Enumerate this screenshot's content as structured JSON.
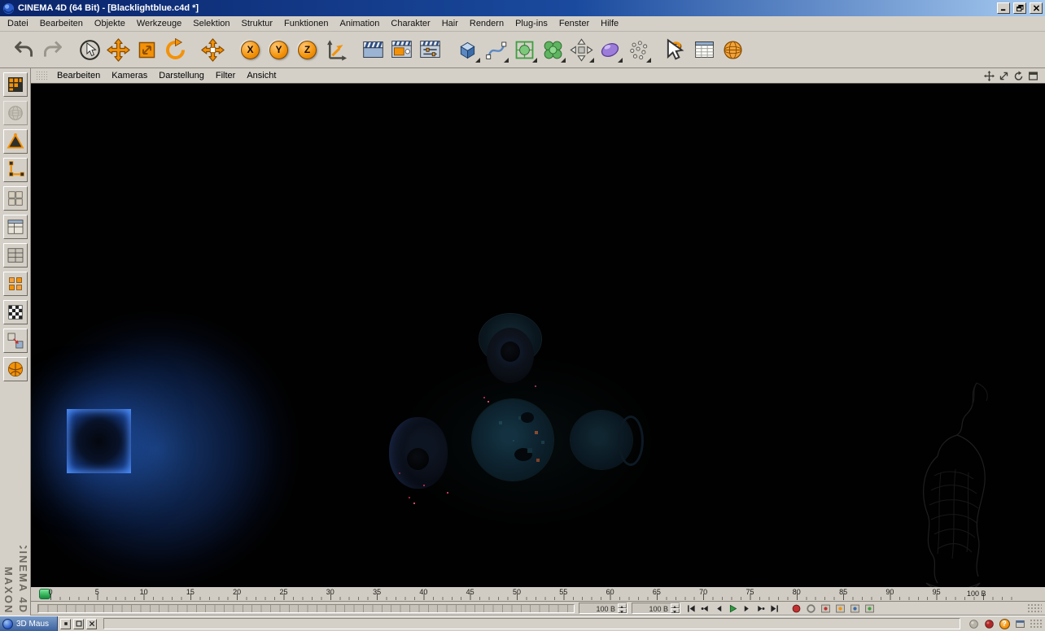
{
  "window": {
    "title": "CINEMA 4D (64 Bit) - [Blacklightblue.c4d *]",
    "control_icons": [
      "minimize-icon",
      "restore-icon",
      "close-icon"
    ]
  },
  "menubar": {
    "items": [
      "Datei",
      "Bearbeiten",
      "Objekte",
      "Werkzeuge",
      "Selektion",
      "Struktur",
      "Funktionen",
      "Animation",
      "Charakter",
      "Hair",
      "Rendern",
      "Plug-ins",
      "Fenster",
      "Hilfe"
    ]
  },
  "toolbar": {
    "icons": [
      {
        "name": "undo-icon"
      },
      {
        "name": "redo-icon"
      },
      {
        "sep": true
      },
      {
        "name": "live-selection-icon"
      },
      {
        "name": "move-tool-icon"
      },
      {
        "name": "scale-tool-icon"
      },
      {
        "name": "rotate-tool-icon"
      },
      {
        "sep": true
      },
      {
        "name": "object-axis-icon"
      },
      {
        "sep": true
      },
      {
        "name": "lock-x-button",
        "label": "X"
      },
      {
        "name": "lock-y-button",
        "label": "Y"
      },
      {
        "name": "lock-z-button",
        "label": "Z"
      },
      {
        "name": "coord-system-icon"
      },
      {
        "sep": true
      },
      {
        "name": "render-view-icon"
      },
      {
        "name": "render-picture-icon"
      },
      {
        "name": "render-settings-icon"
      },
      {
        "sep": true
      },
      {
        "name": "add-cube-icon",
        "flyout": true
      },
      {
        "name": "add-spline-icon",
        "flyout": true
      },
      {
        "name": "add-nurbs-icon",
        "flyout": true
      },
      {
        "name": "add-modeling-icon",
        "flyout": true
      },
      {
        "name": "add-deformer-icon",
        "flyout": true
      },
      {
        "name": "add-scene-icon",
        "flyout": true
      },
      {
        "name": "add-particles-icon",
        "flyout": true
      },
      {
        "sep": true
      },
      {
        "name": "help-icon",
        "label": "?"
      },
      {
        "name": "attributes-icon"
      },
      {
        "name": "content-browser-icon"
      }
    ]
  },
  "left_palette": {
    "icons": [
      {
        "name": "array-grid-icon"
      },
      {
        "name": "earth-icon",
        "disabled": true
      },
      {
        "name": "prism-icon"
      },
      {
        "name": "spline-corner-icon"
      },
      {
        "name": "blocks-icon"
      },
      {
        "name": "window-grid-icon"
      },
      {
        "name": "panel-grid-icon"
      },
      {
        "name": "cubes-array-icon"
      },
      {
        "name": "checker-icon"
      },
      {
        "name": "swap-boxes-icon"
      },
      {
        "name": "orange-sphere-icon"
      }
    ]
  },
  "branding": {
    "line1": "MAXON",
    "line2": "CINEMA 4D"
  },
  "viewport": {
    "menu_items": [
      "Bearbeiten",
      "Kameras",
      "Darstellung",
      "Filter",
      "Ansicht"
    ],
    "nav_icons": [
      "pan-view-icon",
      "zoom-view-icon",
      "rotate-view-icon",
      "toggle-view-icon"
    ]
  },
  "timeline": {
    "tick_labels": [
      "0",
      "5",
      "10",
      "15",
      "20",
      "25",
      "30",
      "35",
      "40",
      "45",
      "50",
      "55",
      "60",
      "65",
      "70",
      "75",
      "80",
      "85",
      "90",
      "95"
    ],
    "end_label": "100 B",
    "current_frame": "0"
  },
  "animation_bar": {
    "fields": [
      {
        "value": "100 B"
      },
      {
        "value": "100 B"
      }
    ],
    "playback_icons": [
      "goto-start-icon",
      "prev-key-icon",
      "prev-frame-icon",
      "play-icon",
      "next-frame-icon",
      "next-key-icon",
      "goto-end-icon"
    ],
    "record_icons": [
      "record-keyframe-icon",
      "autokey-icon",
      "record-position-icon",
      "record-scale-icon",
      "record-rotation-icon",
      "record-parameter-icon"
    ]
  },
  "statusbar": {
    "palette_title": "3D Maus",
    "help_glyph": "?",
    "icons": [
      "status-sphere-grey-icon",
      "status-sphere-red-icon",
      "status-help-icon",
      "dock-window-icon"
    ]
  },
  "colors": {
    "accent_orange": "#f39208",
    "glow_blue": "#2f6fd6",
    "titlebar_blue": "#0a246a"
  }
}
